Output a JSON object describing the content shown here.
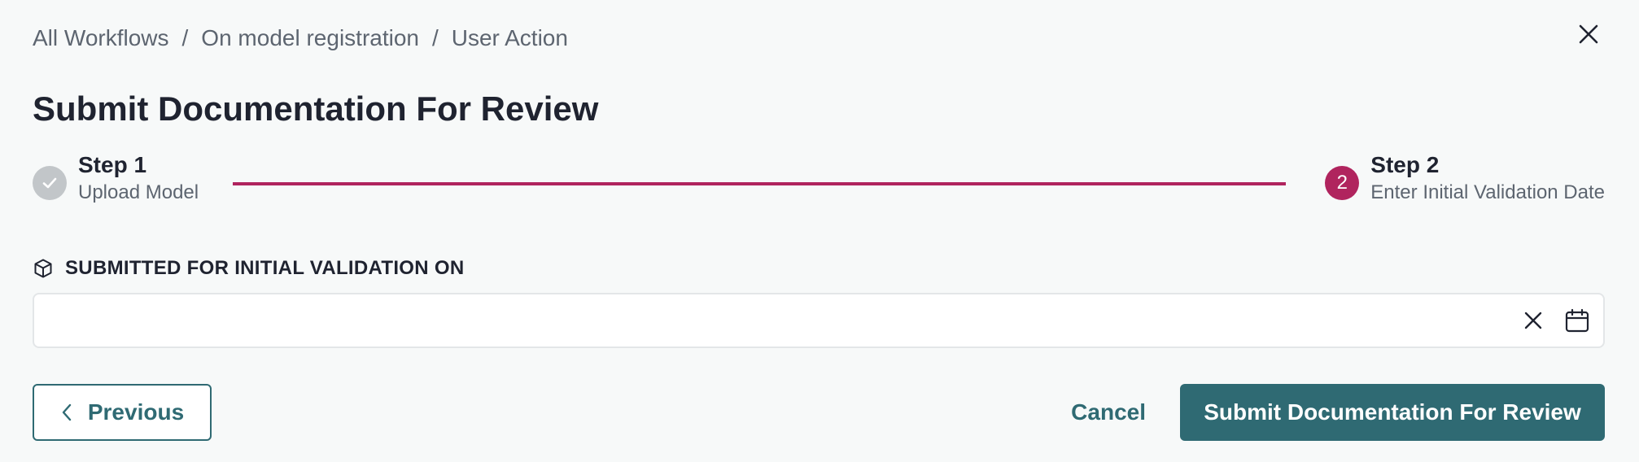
{
  "breadcrumb": {
    "items": [
      "All Workflows",
      "On model registration",
      "User Action"
    ],
    "separator": "/"
  },
  "title": "Submit Documentation For Review",
  "stepper": {
    "steps": [
      {
        "title": "Step 1",
        "subtitle": "Upload Model",
        "status": "completed",
        "icon": "check-icon"
      },
      {
        "title": "Step 2",
        "subtitle": "Enter Initial Validation Date",
        "status": "active",
        "number": "2"
      }
    ],
    "accent_color": "#b0245e"
  },
  "field": {
    "label": "SUBMITTED FOR INITIAL VALIDATION ON",
    "label_icon": "cube-icon",
    "value": "",
    "placeholder": ""
  },
  "footer": {
    "previous_label": "Previous",
    "cancel_label": "Cancel",
    "submit_label": "Submit Documentation For Review"
  },
  "colors": {
    "primary": "#2f6a73",
    "accent": "#b0245e",
    "background": "#f7f9f9"
  }
}
